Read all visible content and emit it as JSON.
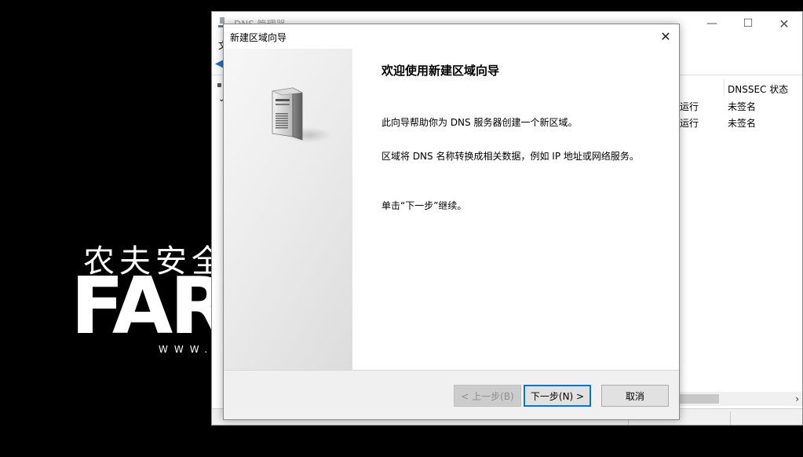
{
  "background": {
    "logo_cn": "农夫安全",
    "logo_en": "FARM",
    "logo_url": "WWW.F"
  },
  "main_window": {
    "title": "DNS 管理器",
    "menu_first": "文",
    "columns": {
      "dnssec": "DNSSEC 状态"
    },
    "rows": [
      {
        "status": "运行",
        "dnssec": "未签名"
      },
      {
        "status": "运行",
        "dnssec": "未签名"
      }
    ],
    "controls": {
      "minimize": "—",
      "maximize": "☐",
      "close": "✕"
    }
  },
  "dialog": {
    "title": "新建区域向导",
    "close": "✕",
    "heading": "欢迎使用新建区域向导",
    "paragraphs": [
      "此向导帮助你为 DNS 服务器创建一个新区域。",
      "区域将 DNS 名称转换成相关数据，例如 IP 地址或网络服务。",
      "单击“下一步”继续。"
    ],
    "buttons": {
      "back": "< 上一步(B)",
      "next": "下一步(N) >",
      "cancel": "取消"
    },
    "banner_icon": "server-icon"
  },
  "colors": {
    "accent": "#0078d7",
    "dialog_bg": "#f0f0f0"
  }
}
